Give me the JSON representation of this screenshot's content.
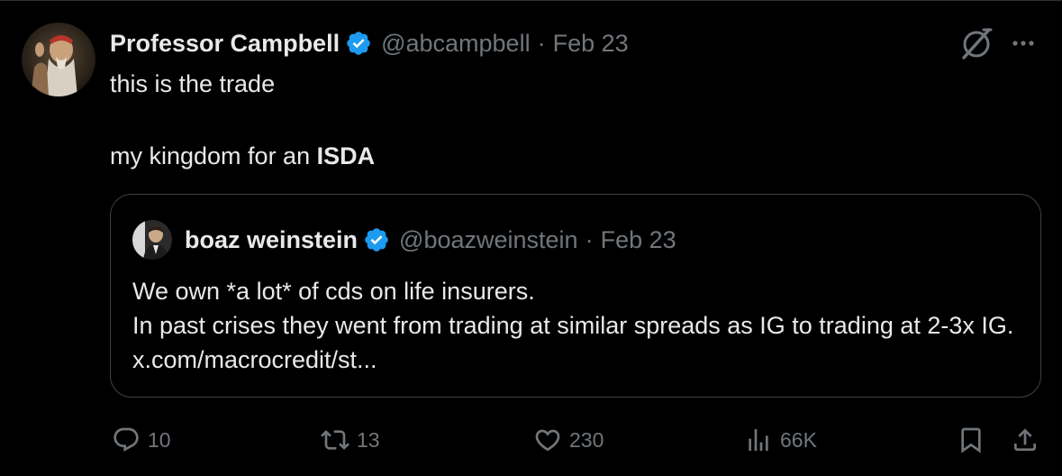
{
  "tweet": {
    "author_name": "Professor Campbell",
    "handle": "@abcampbell",
    "separator": "·",
    "date": "Feb 23",
    "text_line1": "this is the trade",
    "text_line2_prefix": "my kingdom for an ",
    "text_line2_bold": "ISDA"
  },
  "quote": {
    "author_name": "boaz weinstein",
    "handle": "@boazweinstein",
    "separator": "·",
    "date": "Feb 23",
    "text_line1": "We own *a lot* of cds on life insurers.",
    "text_line2": "In past crises they went from trading at similar spreads as IG to trading at 2-3x IG. x.com/macrocredit/st..."
  },
  "actions": {
    "replies": "10",
    "reposts": "13",
    "likes": "230",
    "views": "66K"
  },
  "icons": {
    "verified": "verified-badge-icon",
    "grok": "grok-icon",
    "more": "more-options-icon",
    "reply": "reply-icon",
    "repost": "repost-icon",
    "like": "heart-icon",
    "views": "views-chart-icon",
    "bookmark": "bookmark-icon",
    "share": "share-icon"
  },
  "colors": {
    "background": "#000000",
    "text": "#e7e9ea",
    "muted": "#71767b",
    "verified": "#1d9bf0",
    "border": "#3e4144"
  }
}
